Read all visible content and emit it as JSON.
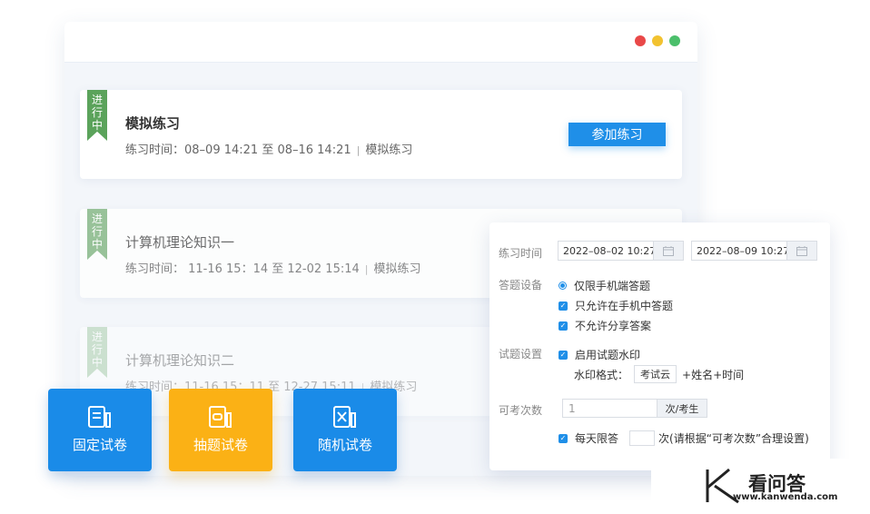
{
  "cards": [
    {
      "ribbon": [
        "进",
        "行",
        "中"
      ],
      "title": "模拟练习",
      "time": "练习时间：08–09 14:21 至 08–16 14:21",
      "type": "模拟练习",
      "button": "参加练习"
    },
    {
      "ribbon": [
        "进",
        "行",
        "中"
      ],
      "title": "计算机理论知识一",
      "time": "练习时间： 11-16 15：14 至 12-02 15:14",
      "type": "模拟练习"
    },
    {
      "ribbon": [
        "进",
        "行",
        "中"
      ],
      "title": "计算机理论知识二",
      "time": "练习时间：11-16 15：11 至 12-27 15:11",
      "type": "模拟练习"
    }
  ],
  "panel": {
    "time_label": "练习时间",
    "start": "2022–08–02 10:27",
    "end": "2022–08–09 10:27",
    "device_label": "答题设备",
    "device_options": [
      "仅限手机端答题",
      "只允许在手机中答题",
      "不允许分享答案"
    ],
    "question_label": "试题设置",
    "watermark_option": "启用试题水印",
    "watermark_format_label": "水印格式：",
    "watermark_value": "考试云",
    "watermark_suffix": "+姓名+时间",
    "count_label": "可考次数",
    "count_value": "1",
    "count_unit": "次/考生",
    "daily_label": "每天限答",
    "daily_suffix": "次(请根据“可考次数”合理设置)"
  },
  "tiles": [
    "固定试卷",
    "抽题试卷",
    "随机试卷"
  ],
  "brand": {
    "name": "看问答",
    "url": "www.kanwenda.com"
  },
  "colors": {
    "accent": "#1f8fe8",
    "ribbon": "#5ba35b",
    "orange": "#fbb115"
  }
}
